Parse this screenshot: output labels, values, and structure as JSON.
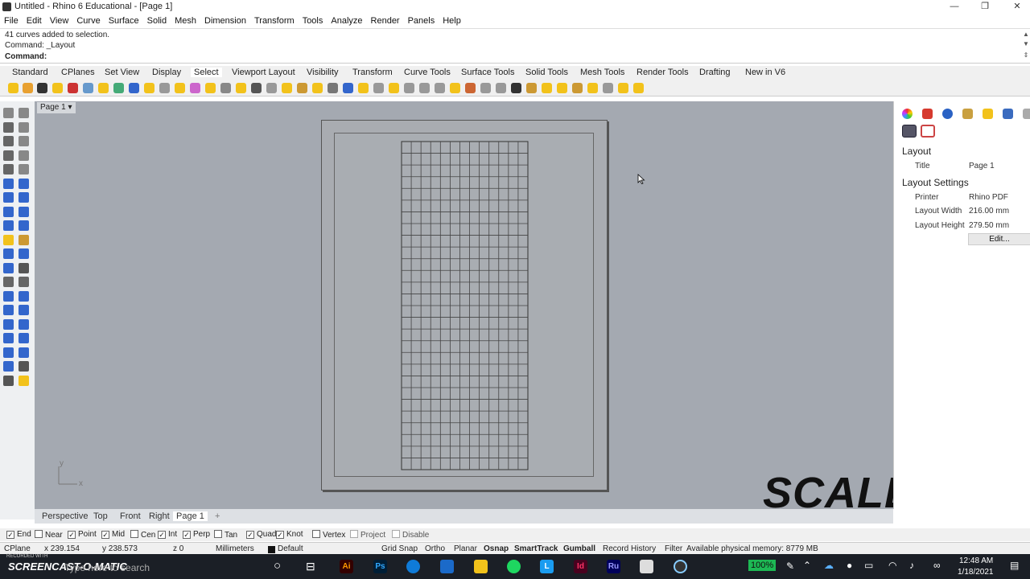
{
  "window": {
    "title": "Untitled - Rhino 6 Educational - [Page 1]",
    "minimize": "—",
    "maximize": "❐",
    "close": "✕"
  },
  "menu": [
    "File",
    "Edit",
    "View",
    "Curve",
    "Surface",
    "Solid",
    "Mesh",
    "Dimension",
    "Transform",
    "Tools",
    "Analyze",
    "Render",
    "Panels",
    "Help"
  ],
  "command": {
    "history1": "41 curves added to selection.",
    "history2": "Command: _Layout",
    "prompt": "Command:",
    "input": ""
  },
  "toolbar_tabs": [
    "Standard",
    "CPlanes",
    "Set View",
    "Display",
    "Select",
    "Viewport Layout",
    "Visibility",
    "Transform",
    "Curve Tools",
    "Surface Tools",
    "Solid Tools",
    "Mesh Tools",
    "Render Tools",
    "Drafting",
    "New in V6"
  ],
  "active_toolbar_tab": "Select",
  "viewport": {
    "page_tab": "Page 1",
    "axis_x": "x",
    "axis_y": "y",
    "grid_columns": 13,
    "grid_rows": 28
  },
  "overlay_text": "SCALE",
  "right_panel": {
    "layout_section": "Layout",
    "title_label": "Title",
    "title_value": "Page 1",
    "settings_section": "Layout Settings",
    "printer_label": "Printer",
    "printer_value": "Rhino PDF",
    "width_label": "Layout Width",
    "width_value": "216.00 mm",
    "height_label": "Layout Height",
    "height_value": "279.50 mm",
    "edit_button": "Edit..."
  },
  "view_tabs": [
    "Perspective",
    "Top",
    "Front",
    "Right",
    "Page 1"
  ],
  "view_tab_add": "+",
  "osnaps": [
    {
      "label": "End",
      "checked": true
    },
    {
      "label": "Near",
      "checked": false
    },
    {
      "label": "Point",
      "checked": true
    },
    {
      "label": "Mid",
      "checked": true
    },
    {
      "label": "Cen",
      "checked": false
    },
    {
      "label": "Int",
      "checked": true
    },
    {
      "label": "Perp",
      "checked": true
    },
    {
      "label": "Tan",
      "checked": false
    },
    {
      "label": "Quad",
      "checked": true
    },
    {
      "label": "Knot",
      "checked": true
    },
    {
      "label": "Vertex",
      "checked": false
    },
    {
      "label": "Project",
      "checked": false
    },
    {
      "label": "Disable",
      "checked": false
    }
  ],
  "status": {
    "cplane": "CPlane",
    "x": "x 239.154",
    "y": "y 238.573",
    "z": "z 0",
    "units": "Millimeters",
    "layer": "Default",
    "grid_snap": "Grid Snap",
    "ortho": "Ortho",
    "planar": "Planar",
    "osnap": "Osnap",
    "smarttrack": "SmartTrack",
    "gumball": "Gumball",
    "record_history": "Record History",
    "filter": "Filter",
    "memory": "Available physical memory: 8779 MB"
  },
  "taskbar": {
    "watermark": "SCREENCAST-O-MATIC",
    "recorded": "RECORDED WITH",
    "search": "Type here to search",
    "zoom": "100%",
    "time": "12:48 AM",
    "date": "1/18/2021",
    "apps": [
      "Ai",
      "Ps",
      "Id",
      "Ru",
      "L"
    ]
  },
  "colors": {
    "viewport_bg": "#a4a9b1",
    "accent_yellow": "#f2c21b",
    "taskbar_bg": "#1b1f26"
  }
}
